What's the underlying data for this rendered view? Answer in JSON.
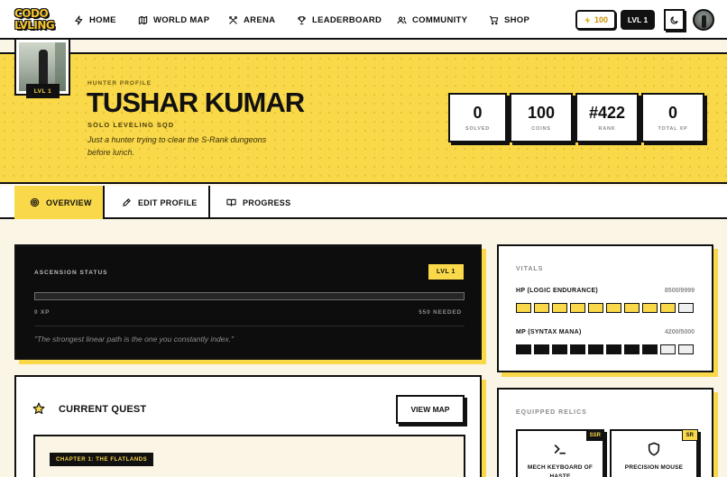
{
  "brand": {
    "logo_line1": "CODO",
    "logo_line2": "LVLING",
    "accent": "#f9d84a",
    "ink": "#111111"
  },
  "nav": {
    "items": [
      {
        "label": "HOME",
        "icon": "lightning-icon"
      },
      {
        "label": "WORLD MAP",
        "icon": "map-icon"
      },
      {
        "label": "ARENA",
        "icon": "swords-icon"
      },
      {
        "label": "LEADERBOARD",
        "icon": "trophy-icon"
      },
      {
        "label": "COMMUNITY",
        "icon": "users-icon"
      },
      {
        "label": "SHOP",
        "icon": "cart-icon"
      }
    ],
    "coins": "100",
    "level": "LVL 1"
  },
  "profile": {
    "label": "HUNTER PROFILE",
    "name": "TUSHAR KUMAR",
    "guild": "SOLO LEVELING SQD",
    "bio": "Just a hunter trying to clear the S-Rank dungeons before lunch.",
    "avatar_level": "LVL 1",
    "stats": [
      {
        "value": "0",
        "label": "SOLVED"
      },
      {
        "value": "100",
        "label": "COINS"
      },
      {
        "value": "#422",
        "label": "RANK"
      },
      {
        "value": "0",
        "label": "TOTAL XP"
      }
    ]
  },
  "tabs": {
    "overview": "OVERVIEW",
    "edit": "EDIT PROFILE",
    "progress": "PROGRESS"
  },
  "ascension": {
    "title": "ASCENSION STATUS",
    "level": "LVL 1",
    "progress": 0,
    "xp": "0 XP",
    "needed": "550 NEEDED",
    "quote": "\"The strongest linear path is the one you constantly index.\""
  },
  "quest": {
    "title": "CURRENT QUEST",
    "button": "VIEW MAP",
    "chapter": "CHAPTER 1: THE FLATLANDS"
  },
  "vitals": {
    "title": "VITALS",
    "hp": {
      "label": "HP (LOGIC ENDURANCE)",
      "value": "8500/9999",
      "filled": 9,
      "total": 10
    },
    "mp": {
      "label": "MP (SYNTAX MANA)",
      "value": "4200/5000",
      "filled": 8,
      "total": 10
    }
  },
  "relics": {
    "title": "EQUIPPED RELICS",
    "items": [
      {
        "name": "MECH KEYBOARD OF HASTE",
        "rarity": "SSR",
        "icon": "terminal-icon"
      },
      {
        "name": "PRECISION MOUSE",
        "rarity": "SR",
        "icon": "shield-icon"
      }
    ]
  }
}
